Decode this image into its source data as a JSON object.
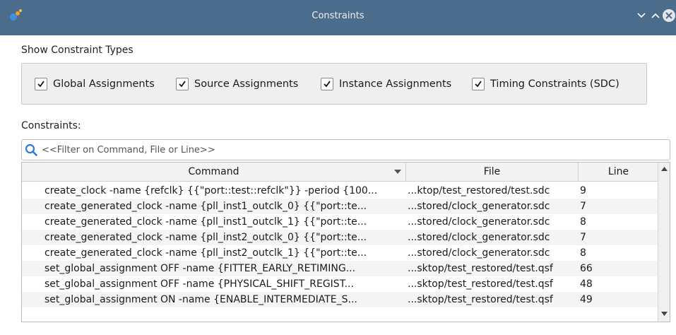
{
  "window": {
    "title": "Constraints",
    "controls": [
      "chevron-down-icon",
      "chevron-up-icon",
      "close-icon"
    ]
  },
  "show_types": {
    "heading": "Show Constraint Types",
    "checkboxes": [
      {
        "label": "Global Assignments",
        "checked": true
      },
      {
        "label": "Source Assignments",
        "checked": true
      },
      {
        "label": "Instance Assignments",
        "checked": true
      },
      {
        "label": "Timing Constraints (SDC)",
        "checked": true
      }
    ]
  },
  "constraints": {
    "heading": "Constraints:",
    "filter_placeholder": "<<Filter on Command, File or Line>>",
    "columns": [
      "Command",
      "File",
      "Line"
    ],
    "rows": [
      {
        "command": "create_clock -name {refclk} {{\"port::test::refclk\"}} -period {100...",
        "file": "...ktop/test_restored/test.sdc",
        "line": "9"
      },
      {
        "command": "create_generated_clock -name {pll_inst1_outclk_0} {{\"port::te...",
        "file": "...stored/clock_generator.sdc",
        "line": "7"
      },
      {
        "command": "create_generated_clock -name {pll_inst1_outclk_1} {{\"port::te...",
        "file": "...stored/clock_generator.sdc",
        "line": "8"
      },
      {
        "command": "create_generated_clock -name {pll_inst2_outclk_0} {{\"port::te...",
        "file": "...stored/clock_generator.sdc",
        "line": "7"
      },
      {
        "command": "create_generated_clock -name {pll_inst2_outclk_1} {{\"port::te...",
        "file": "...stored/clock_generator.sdc",
        "line": "8"
      },
      {
        "command": "set_global_assignment OFF -name {FITTER_EARLY_RETIMING...",
        "file": "...sktop/test_restored/test.qsf",
        "line": "66"
      },
      {
        "command": "set_global_assignment OFF -name {PHYSICAL_SHIFT_REGIST...",
        "file": "...sktop/test_restored/test.qsf",
        "line": "48"
      },
      {
        "command": "set_global_assignment ON -name {ENABLE_INTERMEDIATE_S...",
        "file": "...sktop/test_restored/test.qsf",
        "line": "49"
      }
    ]
  },
  "colors": {
    "titlebar": "#4c6c8c",
    "search_icon": "#2a7ad4",
    "alt_row": "#f4f4f4"
  }
}
